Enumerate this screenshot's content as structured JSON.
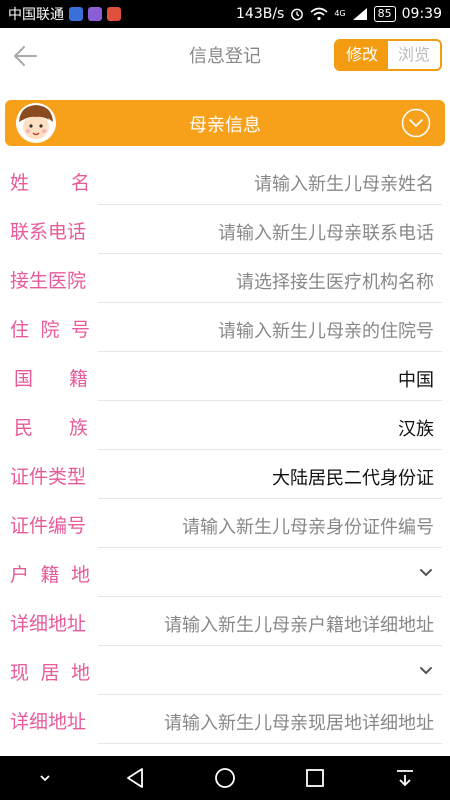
{
  "status_bar": {
    "carrier": "中国联通",
    "speed": "143B/s",
    "network": "4G",
    "battery": "85",
    "time": "09:39"
  },
  "header": {
    "title": "信息登记",
    "toggle_edit": "修改",
    "toggle_browse": "浏览",
    "accent_color": "#f39c12"
  },
  "section": {
    "title": "母亲信息",
    "color": "#f7a11a"
  },
  "form": {
    "label_color": "#e85b9a",
    "rows": [
      {
        "label_chars": [
          "姓",
          "名"
        ],
        "value": "请输入新生儿母亲姓名"
      },
      {
        "label": "联系电话",
        "value": "请输入新生儿母亲联系电话"
      },
      {
        "label": "接生医院",
        "value": "请选择接生医疗机构名称"
      },
      {
        "label_chars": [
          "住",
          "院",
          "号"
        ],
        "value": "请输入新生儿母亲的住院号"
      },
      {
        "label_chars": [
          "国",
          "籍"
        ],
        "value": "中国"
      },
      {
        "label_chars": [
          "民",
          "族"
        ],
        "value": "汉族"
      },
      {
        "label": "证件类型",
        "value": "大陆居民二代身份证"
      },
      {
        "label": "证件编号",
        "value": "请输入新生儿母亲身份证件编号"
      },
      {
        "label_chars": [
          "户",
          "籍",
          "地"
        ],
        "value": ""
      },
      {
        "label": "详细地址",
        "value": "请输入新生儿母亲户籍地详细地址"
      },
      {
        "label_chars": [
          "现",
          "居",
          "地"
        ],
        "value": ""
      },
      {
        "label": "详细地址",
        "value": "请输入新生儿母亲现居地详细地址"
      }
    ]
  }
}
